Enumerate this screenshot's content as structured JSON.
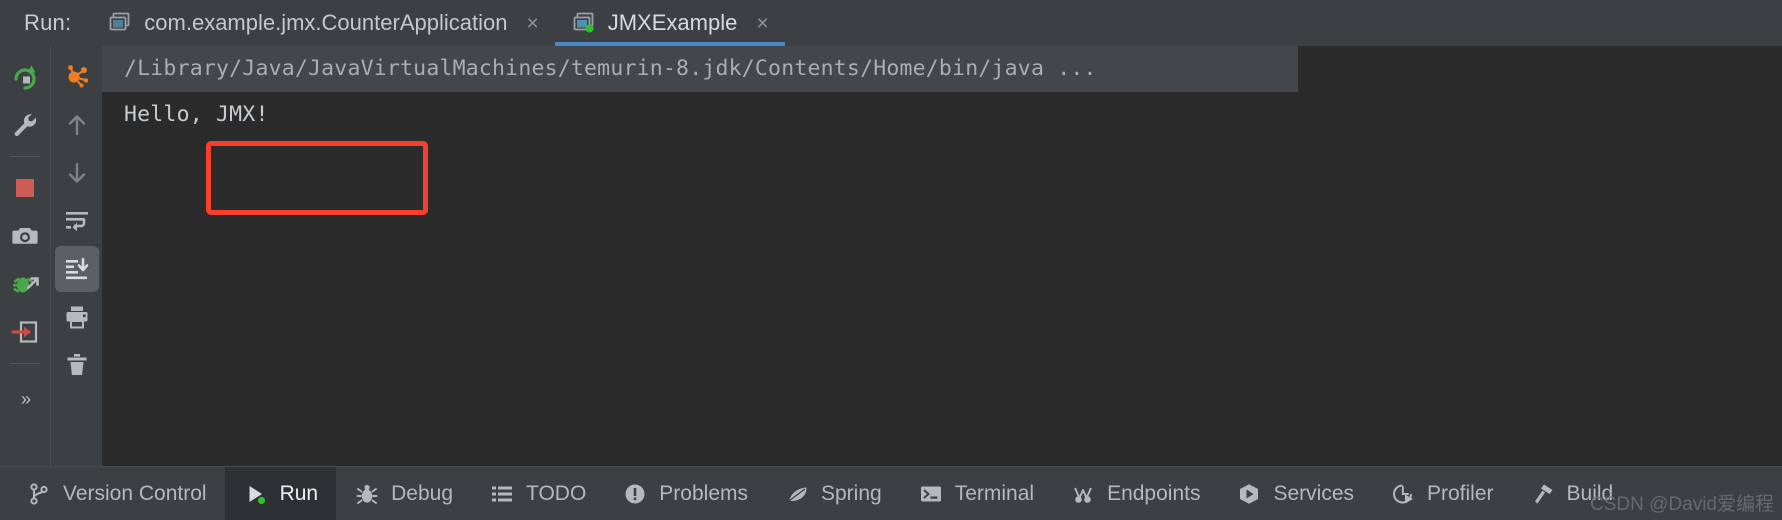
{
  "window": {
    "run_label": "Run:"
  },
  "tabs": [
    {
      "title": "com.example.jmx.CounterApplication",
      "icon": "run-config-icon",
      "close_label": "×",
      "active": false,
      "running": false
    },
    {
      "title": "JMXExample",
      "icon": "run-config-icon",
      "close_label": "×",
      "active": true,
      "running": true
    }
  ],
  "left_toolbar": {
    "buttons": [
      {
        "name": "rerun-button",
        "icon": "rerun-icon",
        "title": "Rerun"
      },
      {
        "name": "edit-configuration-button",
        "icon": "wrench-icon",
        "title": "Modify Run Configuration"
      },
      {
        "name": "stop-button",
        "icon": "stop-square-icon",
        "title": "Stop"
      },
      {
        "name": "screenshot-button",
        "icon": "camera-icon",
        "title": "Capture Screenshot"
      },
      {
        "name": "attach-debugger-button",
        "icon": "bug-arrow-icon",
        "title": "Attach Debugger"
      },
      {
        "name": "import-button",
        "icon": "arrow-into-box-icon",
        "title": "Import"
      }
    ],
    "overflow_label": "»"
  },
  "right_toolbar": {
    "buttons": [
      {
        "name": "analyze-threads-button",
        "icon": "orange-molecule-icon",
        "title": "Analyze"
      },
      {
        "name": "previous-occurrence-button",
        "icon": "arrow-up-icon",
        "title": "Up the Stack Trace"
      },
      {
        "name": "next-occurrence-button",
        "icon": "arrow-down-icon",
        "title": "Down the Stack Trace"
      },
      {
        "name": "soft-wrap-button",
        "icon": "soft-wrap-icon",
        "title": "Soft-Wrap"
      },
      {
        "name": "scroll-to-end-button",
        "icon": "scroll-to-end-icon",
        "title": "Scroll to the End",
        "selected": true
      },
      {
        "name": "print-button",
        "icon": "printer-icon",
        "title": "Print"
      },
      {
        "name": "clear-all-button",
        "icon": "trash-icon",
        "title": "Clear All"
      }
    ]
  },
  "console": {
    "lines": [
      {
        "text": "/Library/Java/JavaVirtualMachines/temurin-8.jdk/Contents/Home/bin/java ...",
        "type": "command"
      },
      {
        "text": "Hello, JMX!",
        "type": "output",
        "highlighted": true
      }
    ],
    "highlight_color": "#f8402c"
  },
  "statusbar": {
    "items": [
      {
        "label": "Version Control",
        "icon": "branch-icon",
        "active": false
      },
      {
        "label": "Run",
        "icon": "play-green-dot-icon",
        "active": true
      },
      {
        "label": "Debug",
        "icon": "bug-icon",
        "active": false
      },
      {
        "label": "TODO",
        "icon": "list-icon",
        "active": false
      },
      {
        "label": "Problems",
        "icon": "exclamation-circle-icon",
        "active": false
      },
      {
        "label": "Spring",
        "icon": "spring-leaf-icon",
        "active": false
      },
      {
        "label": "Terminal",
        "icon": "terminal-icon",
        "active": false
      },
      {
        "label": "Endpoints",
        "icon": "endpoints-icon",
        "active": false
      },
      {
        "label": "Services",
        "icon": "services-icon",
        "active": false
      },
      {
        "label": "Profiler",
        "icon": "profiler-icon",
        "active": false
      },
      {
        "label": "Build",
        "icon": "hammer-icon",
        "active": false
      }
    ]
  },
  "watermark": {
    "text": "CSDN @David爱编程"
  },
  "colors": {
    "accent_blue": "#4a88c7",
    "running_green": "#3fbf3f",
    "highlight_red": "#f8402c",
    "panel_bg": "#3c4043",
    "console_bg": "#2b2b2b"
  }
}
